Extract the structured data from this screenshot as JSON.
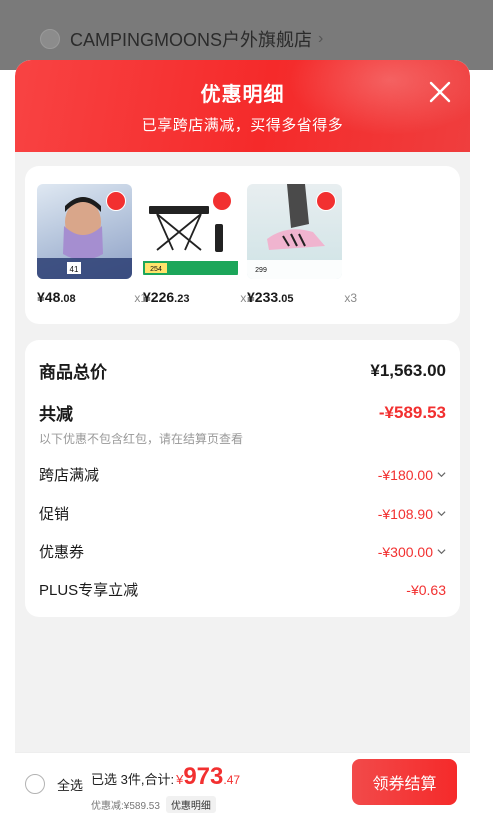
{
  "background": {
    "store_name": "CAMPINGMOONS户外旗舰店"
  },
  "sheet": {
    "title": "优惠明细",
    "subtitle": "已享跨店满减，买得多省得多",
    "close_icon": "close-icon"
  },
  "products": [
    {
      "price_int": "¥48",
      "price_dec": ".08",
      "qty": "x1",
      "thumb_text": "41",
      "colors": [
        "#c9d7e6",
        "#7f8fb3"
      ]
    },
    {
      "price_int": "¥226",
      "price_dec": ".23",
      "qty": "x1",
      "thumb_text": "254",
      "colors": [
        "#ffffff",
        "#1b1b1b"
      ]
    },
    {
      "price_int": "¥233",
      "price_dec": ".05",
      "qty": "x3",
      "thumb_text": "299",
      "colors": [
        "#cfe3e6",
        "#e7a9c7"
      ]
    }
  ],
  "summary": {
    "total_label": "商品总价",
    "total_value": "¥1,563.00",
    "reduce_label": "共减",
    "reduce_value": "-¥589.53",
    "note": "以下优惠不包含红包，请在结算页查看",
    "items": [
      {
        "label": "跨店满减",
        "value": "-¥180.00",
        "expandable": true
      },
      {
        "label": "促销",
        "value": "-¥108.90",
        "expandable": true
      },
      {
        "label": "优惠券",
        "value": "-¥300.00",
        "expandable": true
      },
      {
        "label": "PLUS专享立减",
        "value": "-¥0.63",
        "expandable": false
      }
    ]
  },
  "bottom_bar": {
    "select_all": "全选",
    "selected_text": "已选 3件,合计:",
    "yen": "¥",
    "total_int": "973",
    "total_dec": ".47",
    "discount_text": "优惠减:¥589.53",
    "detail_label": "优惠明细",
    "checkout_label": "领券结算"
  },
  "colors": {
    "accent": "#f23030",
    "header_red": "#f52a2a"
  }
}
